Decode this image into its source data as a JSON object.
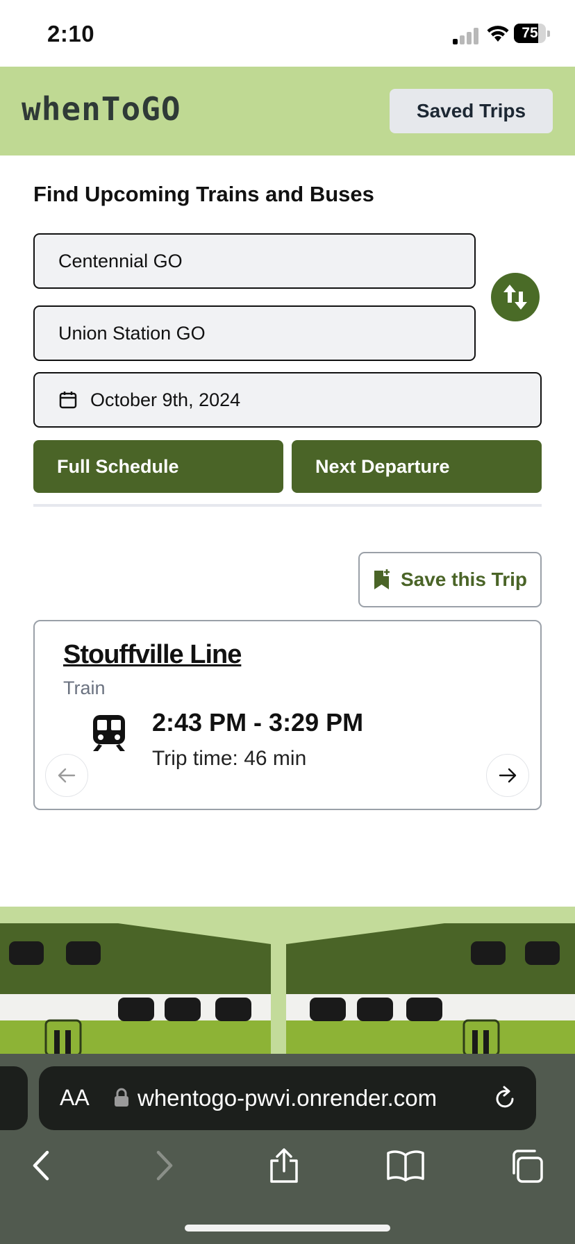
{
  "status_bar": {
    "time": "2:10",
    "battery": "75",
    "battery_level": 0.75
  },
  "header": {
    "logo": "whenToGO",
    "saved_trips_label": "Saved Trips"
  },
  "search": {
    "heading": "Find Upcoming Trains and Buses",
    "from_value": "Centennial GO",
    "to_value": "Union Station GO",
    "date_value": "October 9th, 2024",
    "full_schedule_label": "Full Schedule",
    "next_departure_label": "Next Departure"
  },
  "save_trip_label": "Save this Trip",
  "trip": {
    "line": "Stouffville Line",
    "mode": "Train",
    "times": "2:43 PM - 3:29 PM",
    "trip_time": "Trip time: 46 min"
  },
  "browser": {
    "aa_label": "AA",
    "url": "whentogo-pwvi.onrender.com"
  },
  "colors": {
    "header_bg": "#bfd993",
    "primary_green": "#4a6427",
    "field_bg": "#f1f2f4",
    "browser_bg": "#515a4f"
  },
  "icons": [
    "swap-icon",
    "calendar-icon",
    "bookmark-add-icon",
    "train-icon",
    "arrow-left-icon",
    "arrow-right-icon",
    "lock-icon",
    "reload-icon",
    "back-icon",
    "forward-icon",
    "share-icon",
    "bookmarks-icon",
    "tabs-icon"
  ]
}
